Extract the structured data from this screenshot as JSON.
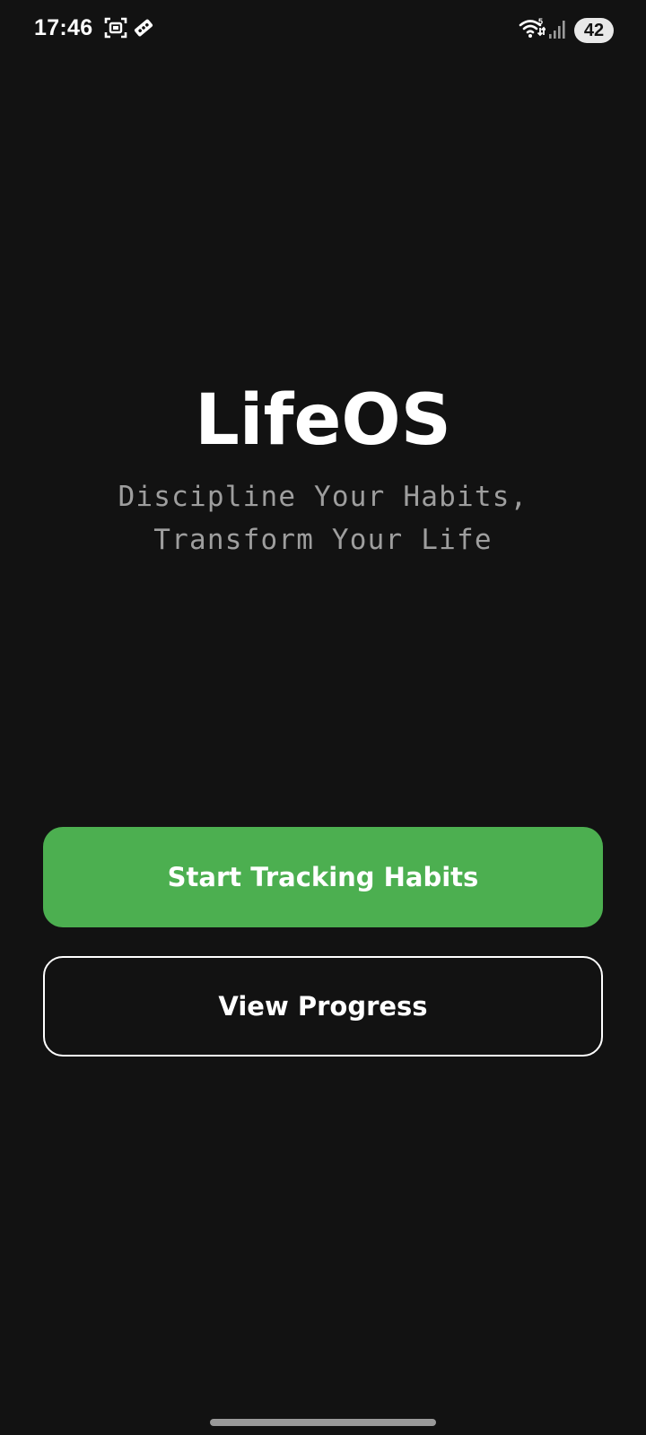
{
  "status_bar": {
    "time": "17:46",
    "battery": "42",
    "icons": [
      "screenshot-icon",
      "media-icon",
      "wifi-icon",
      "signal-icon"
    ]
  },
  "hero": {
    "title": "LifeOS",
    "tagline_line1": "Discipline Your Habits,",
    "tagline_line2": "Transform Your Life"
  },
  "actions": {
    "primary_label": "Start Tracking Habits",
    "secondary_label": "View Progress"
  },
  "colors": {
    "background": "#121212",
    "primary_button": "#4caf50",
    "tagline_text": "#9e9e9e",
    "text": "#ffffff"
  }
}
